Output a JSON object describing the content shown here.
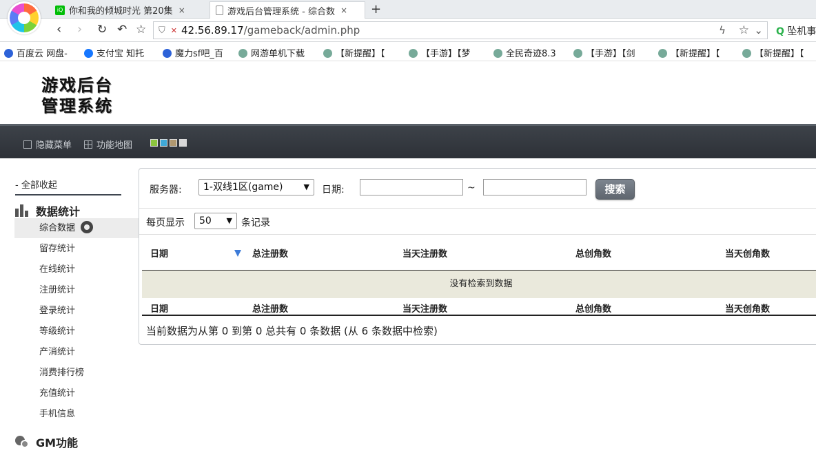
{
  "browser": {
    "tabs": [
      {
        "title": "你和我的倾城时光 第20集",
        "close": "×"
      },
      {
        "title": "游戏后台管理系统 - 综合数",
        "close": "×"
      }
    ],
    "new_tab": "+",
    "url_host": "42.56.89.17",
    "url_path": "/gameback/admin.php",
    "search_hint": "坠机事",
    "bookmarks": [
      "百度云 网盘-",
      "支付宝 知托",
      "魔力sf吧_百",
      "网游单机下载",
      "【新提醒】【",
      "【手游】【梦",
      "全民奇迹8.3",
      "【手游】【剑",
      "【新提醒】【",
      "【新提醒】【"
    ]
  },
  "header": {
    "logo_line1": "游戏后台",
    "logo_line2": "管理系统"
  },
  "topnav": {
    "hide_menu": "隐藏菜单",
    "feature_map": "功能地图",
    "skin_colors": [
      "#8cc63f",
      "#3fa9d8",
      "#b09870",
      "#d8d8d8"
    ]
  },
  "sidebar": {
    "collapse_all": "- 全部收起",
    "group_stats": "数据统计",
    "items": [
      {
        "label": "综合数据",
        "active": true
      },
      {
        "label": "留存统计"
      },
      {
        "label": "在线统计"
      },
      {
        "label": "注册统计"
      },
      {
        "label": "登录统计"
      },
      {
        "label": "等级统计"
      },
      {
        "label": "产消统计"
      },
      {
        "label": "消费排行榜"
      },
      {
        "label": "充值统计"
      },
      {
        "label": "手机信息"
      }
    ],
    "group_gm": "GM功能"
  },
  "filter": {
    "server_label": "服务器:",
    "server_value": "1-双线1区(game)",
    "date_label": "日期:",
    "date_sep": "~",
    "search_button": "搜索"
  },
  "length": {
    "prefix": "每页显示",
    "value": "50",
    "suffix": "条记录"
  },
  "table": {
    "columns": [
      "日期",
      "总注册数",
      "当天注册数",
      "总创角数",
      "当天创角数"
    ],
    "empty_text": "没有检索到数据",
    "info": "当前数据为从第 0 到第 0 总共有 0 条数据 (从 6 条数据中检索)"
  }
}
